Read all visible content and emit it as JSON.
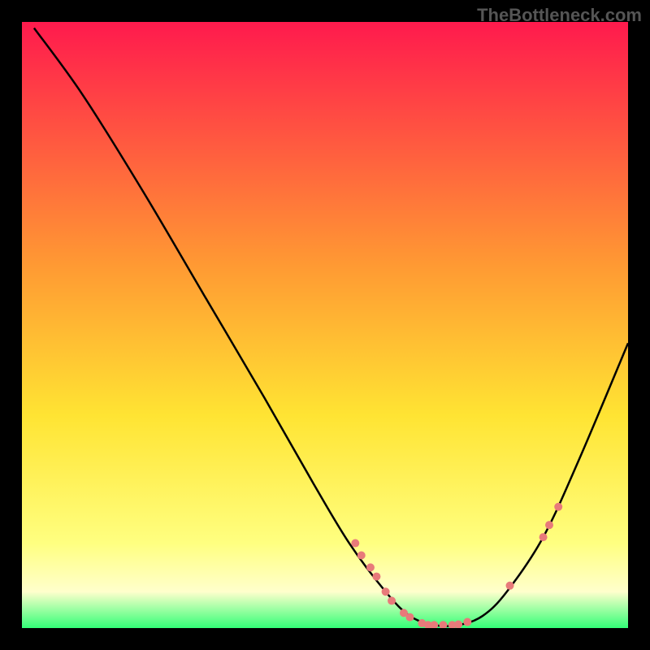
{
  "watermark": "TheBottleneck.com",
  "chart_data": {
    "type": "line",
    "title": "",
    "xlabel": "",
    "ylabel": "",
    "xlim": [
      0,
      100
    ],
    "ylim": [
      0,
      100
    ],
    "background": {
      "gradient_stops": [
        {
          "offset": 0,
          "color": "#ff1a4d"
        },
        {
          "offset": 40,
          "color": "#ff9933"
        },
        {
          "offset": 65,
          "color": "#ffe433"
        },
        {
          "offset": 86,
          "color": "#ffff80"
        },
        {
          "offset": 94,
          "color": "#ffffcc"
        },
        {
          "offset": 100,
          "color": "#33ff77"
        }
      ]
    },
    "curve": {
      "color": "#000000",
      "points": [
        {
          "x": 2,
          "y": 99
        },
        {
          "x": 10,
          "y": 88
        },
        {
          "x": 20,
          "y": 72
        },
        {
          "x": 30,
          "y": 55
        },
        {
          "x": 40,
          "y": 38
        },
        {
          "x": 48,
          "y": 24
        },
        {
          "x": 54,
          "y": 14
        },
        {
          "x": 60,
          "y": 6
        },
        {
          "x": 64,
          "y": 2
        },
        {
          "x": 68,
          "y": 0.5
        },
        {
          "x": 72,
          "y": 0.5
        },
        {
          "x": 76,
          "y": 2
        },
        {
          "x": 80,
          "y": 6
        },
        {
          "x": 86,
          "y": 15
        },
        {
          "x": 92,
          "y": 28
        },
        {
          "x": 100,
          "y": 47
        }
      ]
    },
    "markers": {
      "color": "#e87a7a",
      "radius": 5,
      "points": [
        {
          "x": 55,
          "y": 14
        },
        {
          "x": 56,
          "y": 12
        },
        {
          "x": 57.5,
          "y": 10
        },
        {
          "x": 58.5,
          "y": 8.5
        },
        {
          "x": 60,
          "y": 6
        },
        {
          "x": 61,
          "y": 4.5
        },
        {
          "x": 63,
          "y": 2.5
        },
        {
          "x": 64,
          "y": 1.8
        },
        {
          "x": 66,
          "y": 0.8
        },
        {
          "x": 67,
          "y": 0.5
        },
        {
          "x": 68,
          "y": 0.5
        },
        {
          "x": 69.5,
          "y": 0.5
        },
        {
          "x": 71,
          "y": 0.5
        },
        {
          "x": 72,
          "y": 0.6
        },
        {
          "x": 73.5,
          "y": 1
        },
        {
          "x": 80.5,
          "y": 7
        },
        {
          "x": 86,
          "y": 15
        },
        {
          "x": 87,
          "y": 17
        },
        {
          "x": 88.5,
          "y": 20
        }
      ]
    }
  }
}
